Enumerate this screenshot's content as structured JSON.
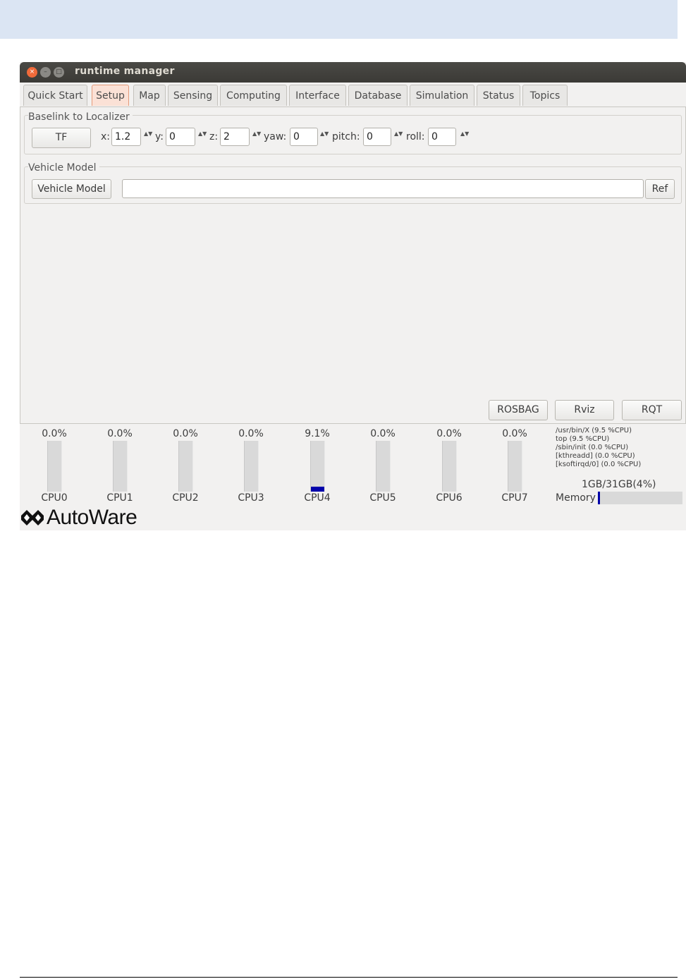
{
  "window": {
    "title": "runtime manager"
  },
  "window_buttons": {
    "close": "×",
    "minimize": "–",
    "maximize": "□"
  },
  "tabs": [
    {
      "label": "Quick Start"
    },
    {
      "label": "Setup"
    },
    {
      "label": "Map"
    },
    {
      "label": "Sensing"
    },
    {
      "label": "Computing"
    },
    {
      "label": "Interface"
    },
    {
      "label": "Database"
    },
    {
      "label": "Simulation"
    },
    {
      "label": "Status"
    },
    {
      "label": "Topics"
    }
  ],
  "active_tab": "Setup",
  "baselink": {
    "group_label": "Baselink to Localizer",
    "tf_button": "TF",
    "x_label": "x:",
    "x_value": "1.2",
    "y_label": "y:",
    "y_value": "0",
    "z_label": "z:",
    "z_value": "2",
    "yaw_label": "yaw:",
    "yaw_value": "0",
    "pitch_label": "pitch:",
    "pitch_value": "0",
    "roll_label": "roll:",
    "roll_value": "0",
    "spin_glyph": "▲▼"
  },
  "vehicle_model": {
    "group_label": "Vehicle Model",
    "button": "Vehicle Model",
    "path_value": "",
    "ref_button": "Ref"
  },
  "bottom_buttons": {
    "rosbag": "ROSBAG",
    "rviz": "Rviz",
    "rqt": "RQT"
  },
  "cpus": [
    {
      "label": "CPU0",
      "percent_text": "0.0%",
      "usage": 0.0
    },
    {
      "label": "CPU1",
      "percent_text": "0.0%",
      "usage": 0.0
    },
    {
      "label": "CPU2",
      "percent_text": "0.0%",
      "usage": 0.0
    },
    {
      "label": "CPU3",
      "percent_text": "0.0%",
      "usage": 0.0
    },
    {
      "label": "CPU4",
      "percent_text": "9.1%",
      "usage": 9.1
    },
    {
      "label": "CPU5",
      "percent_text": "0.0%",
      "usage": 0.0
    },
    {
      "label": "CPU6",
      "percent_text": "0.0%",
      "usage": 0.0
    },
    {
      "label": "CPU7",
      "percent_text": "0.0%",
      "usage": 0.0
    }
  ],
  "processes": [
    "/usr/bin/X (9.5 %CPU)",
    "top (9.5 %CPU)",
    "/sbin/init (0.0 %CPU)",
    "[kthreadd] (0.0 %CPU)",
    "[ksoftirqd/0] (0.0 %CPU)"
  ],
  "memory": {
    "label": "Memory",
    "usage_text": "1GB/31GB(4%)",
    "usage_percent": 4
  },
  "logo": {
    "text": "AutoWare"
  },
  "colors": {
    "accent_tab": "#fbe1d6",
    "usage_fill": "#0000aa",
    "titlebar": "#3b3a36",
    "header_band": "#dbe5f3"
  }
}
